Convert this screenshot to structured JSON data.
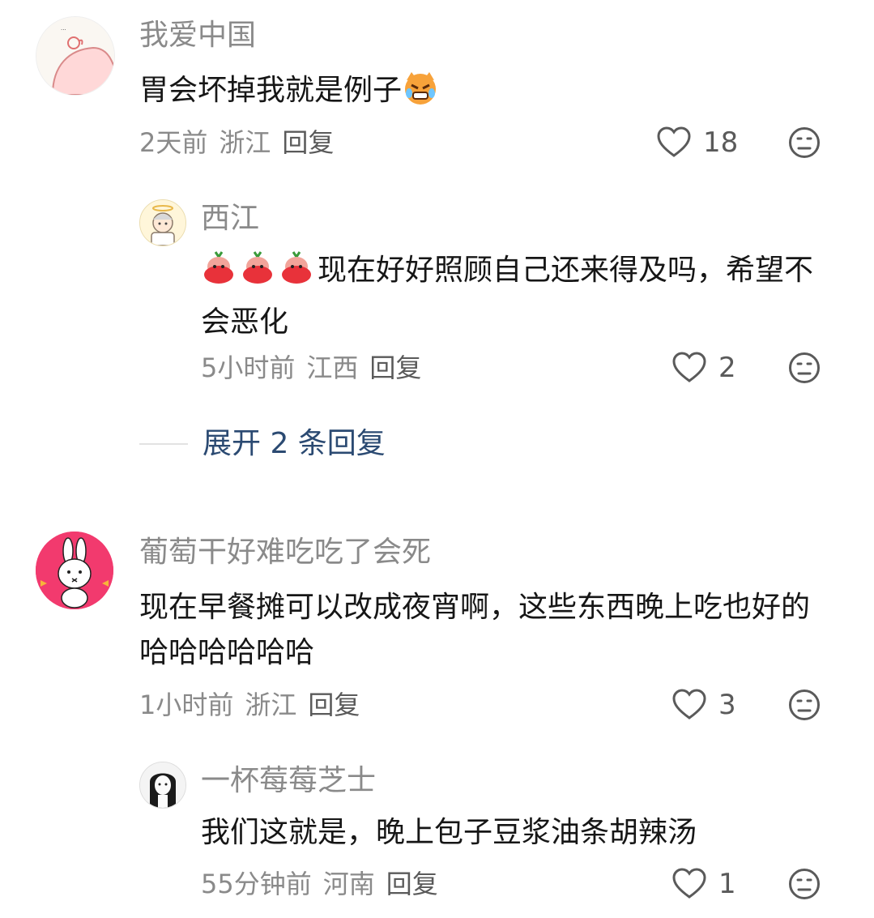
{
  "comments": [
    {
      "username": "我爱中国",
      "text": "胃会坏掉我就是例子",
      "emoji": "crying-cat-emoji",
      "time": "2天前",
      "location": "浙江",
      "reply_label": "回复",
      "likes": "18",
      "replies": [
        {
          "username": "西江",
          "emoji_prefix": "strawberry-emoji",
          "text": "现在好好照顾自己还来得及吗，希望不会恶化",
          "time": "5小时前",
          "location": "江西",
          "reply_label": "回复",
          "likes": "2"
        }
      ],
      "expand_label": "展开 2 条回复"
    },
    {
      "username": "葡萄干好难吃吃了会死",
      "text": "现在早餐摊可以改成夜宵啊，这些东西晚上吃也好的哈哈哈哈哈哈",
      "time": "1小时前",
      "location": "浙江",
      "reply_label": "回复",
      "likes": "3",
      "replies": [
        {
          "username": "一杯莓莓芝士",
          "text": "我们这就是，晚上包子豆浆油条胡辣汤",
          "time": "55分钟前",
          "location": "河南",
          "reply_label": "回复",
          "likes": "1"
        }
      ]
    }
  ],
  "colors": {
    "username": "#8a8a8a",
    "text": "#161616",
    "meta": "#8a8a8a",
    "expand": "#2b4a72",
    "avatar2_bg": "#f23a6e"
  }
}
